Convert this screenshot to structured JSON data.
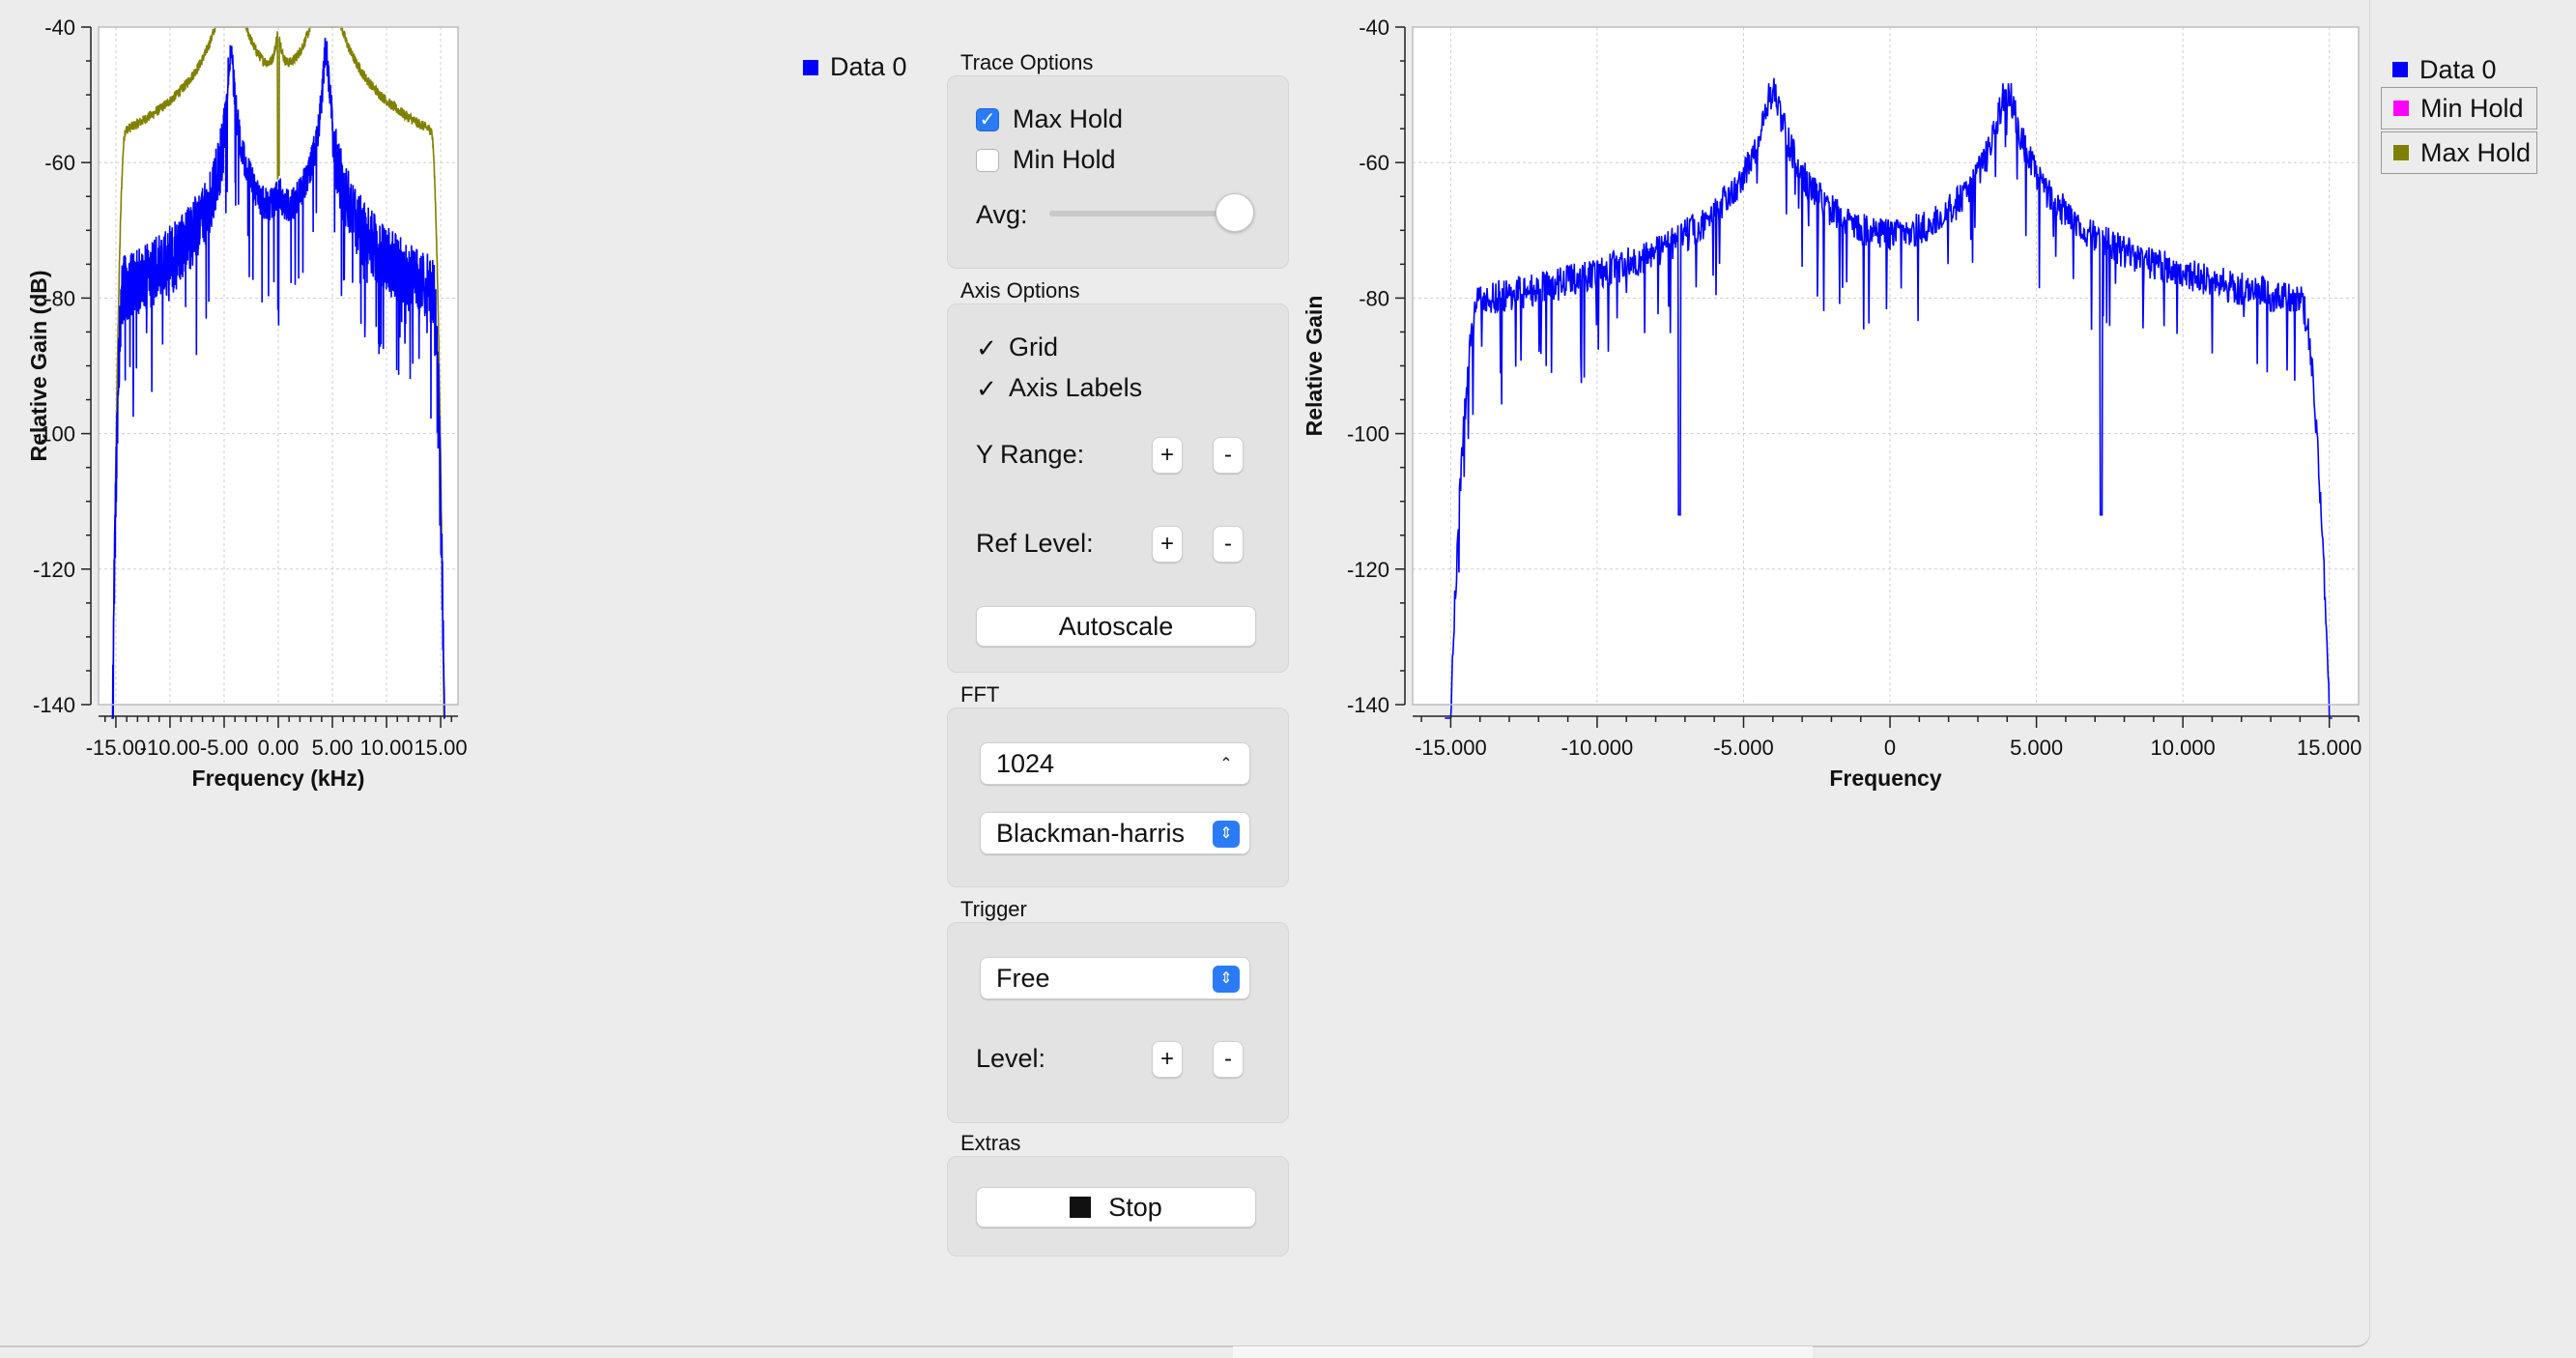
{
  "colors": {
    "data0": "#0000ff",
    "min_hold": "#ff00ff",
    "max_hold": "#808000"
  },
  "left_plot": {
    "ylabel": "Relative Gain (dB)",
    "xlabel": "Frequency (kHz)",
    "ytick_labels": [
      "-40",
      "-60",
      "-80",
      "-100",
      "-120",
      "-140"
    ],
    "xtick_labels": [
      "-15.00",
      "-10.00",
      "-5.00",
      "0.00",
      "5.00",
      "10.00",
      "15.00"
    ],
    "legend": [
      "Data 0"
    ]
  },
  "right_plot": {
    "ylabel": "Relative Gain",
    "xlabel": "Frequency",
    "ytick_labels": [
      "-40",
      "-60",
      "-80",
      "-100",
      "-120",
      "-140"
    ],
    "xtick_labels": [
      "-15.000",
      "-10.000",
      "-5.000",
      "0",
      "5.000",
      "10.000",
      "15.000"
    ],
    "legend": [
      "Data 0",
      "Min Hold",
      "Max Hold"
    ]
  },
  "controls": {
    "trace_options": {
      "title": "Trace Options",
      "max_hold": "Max Hold",
      "min_hold": "Min Hold",
      "max_hold_checked": true,
      "min_hold_checked": false,
      "avg_label": "Avg:",
      "avg_value": 1.0
    },
    "axis_options": {
      "title": "Axis Options",
      "grid": "Grid",
      "axis_labels": "Axis Labels",
      "y_range": "Y Range:",
      "ref_level": "Ref Level:",
      "plus": "+",
      "minus": "-",
      "autoscale": "Autoscale"
    },
    "fft": {
      "title": "FFT",
      "size": "1024",
      "window": "Blackman-harris"
    },
    "trigger": {
      "title": "Trigger",
      "mode": "Free",
      "level": "Level:"
    },
    "extras": {
      "title": "Extras",
      "stop": "Stop"
    },
    "icons": {
      "stop": "stop-square-icon",
      "check": "checkmark-icon",
      "stepper": "up-down-chevron-icon"
    }
  }
}
